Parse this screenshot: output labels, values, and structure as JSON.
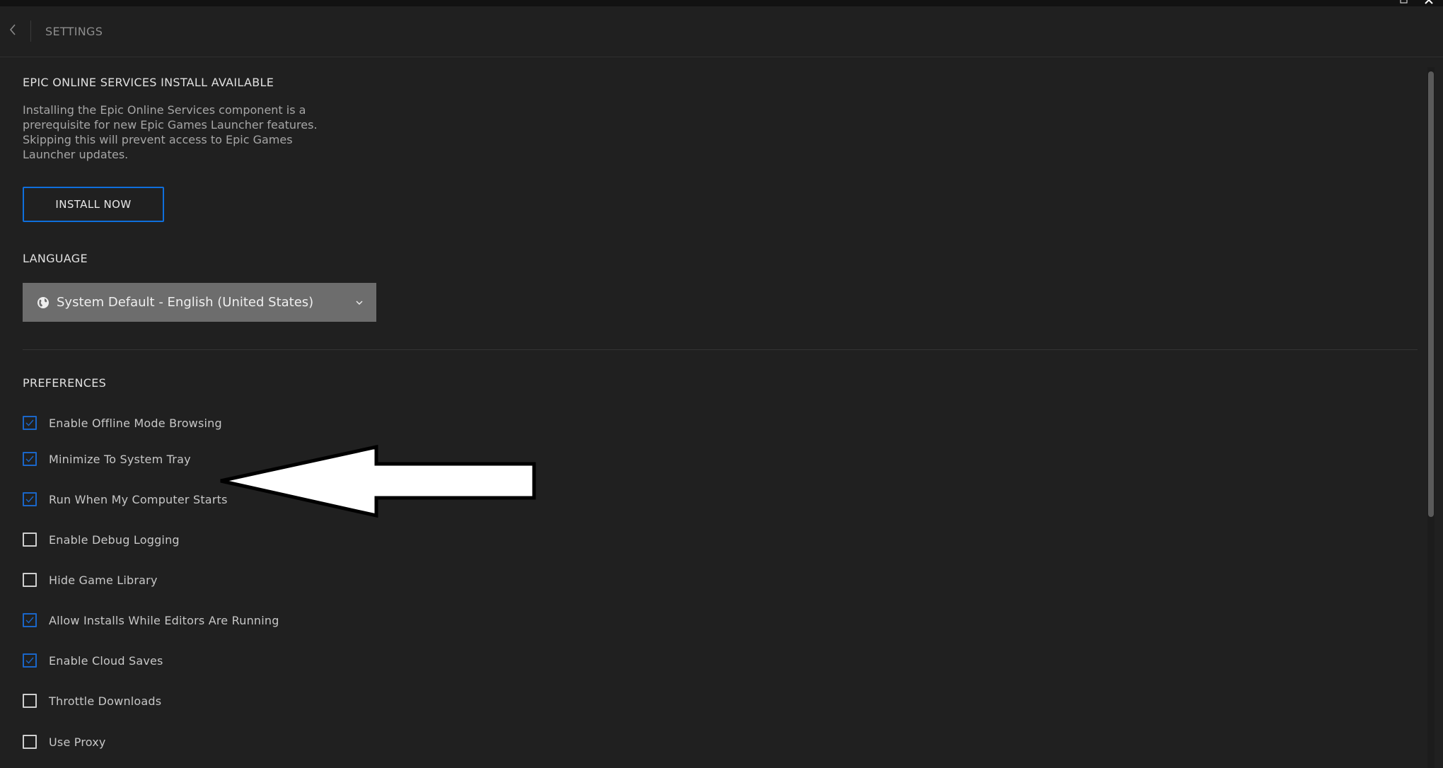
{
  "header": {
    "title": "SETTINGS"
  },
  "eos": {
    "title": "EPIC ONLINE SERVICES INSTALL AVAILABLE",
    "description": "Installing the Epic Online Services component is a prerequisite for new Epic Games Launcher features. Skipping this will prevent access to Epic Games Launcher updates.",
    "install_button": "INSTALL NOW"
  },
  "language": {
    "title": "LANGUAGE",
    "selected": "System Default - English (United States)",
    "icon": "globe-icon",
    "dropdown_icon": "chevron-down-icon"
  },
  "preferences": {
    "title": "PREFERENCES",
    "items": [
      {
        "label": "Enable Offline Mode Browsing",
        "checked": true
      },
      {
        "label": "Minimize To System Tray",
        "checked": true
      },
      {
        "label": "Run When My Computer Starts",
        "checked": true
      },
      {
        "label": "Enable Debug Logging",
        "checked": false
      },
      {
        "label": "Hide Game Library",
        "checked": false
      },
      {
        "label": "Allow Installs While Editors Are Running",
        "checked": true
      },
      {
        "label": "Enable Cloud Saves",
        "checked": true
      },
      {
        "label": "Throttle Downloads",
        "checked": false
      },
      {
        "label": "Use Proxy",
        "checked": false
      }
    ]
  },
  "colors": {
    "background": "#202020",
    "accent": "#0f6fdc",
    "checkbox_checked": "#1a66c8",
    "select_bg": "#6d6d6d"
  }
}
